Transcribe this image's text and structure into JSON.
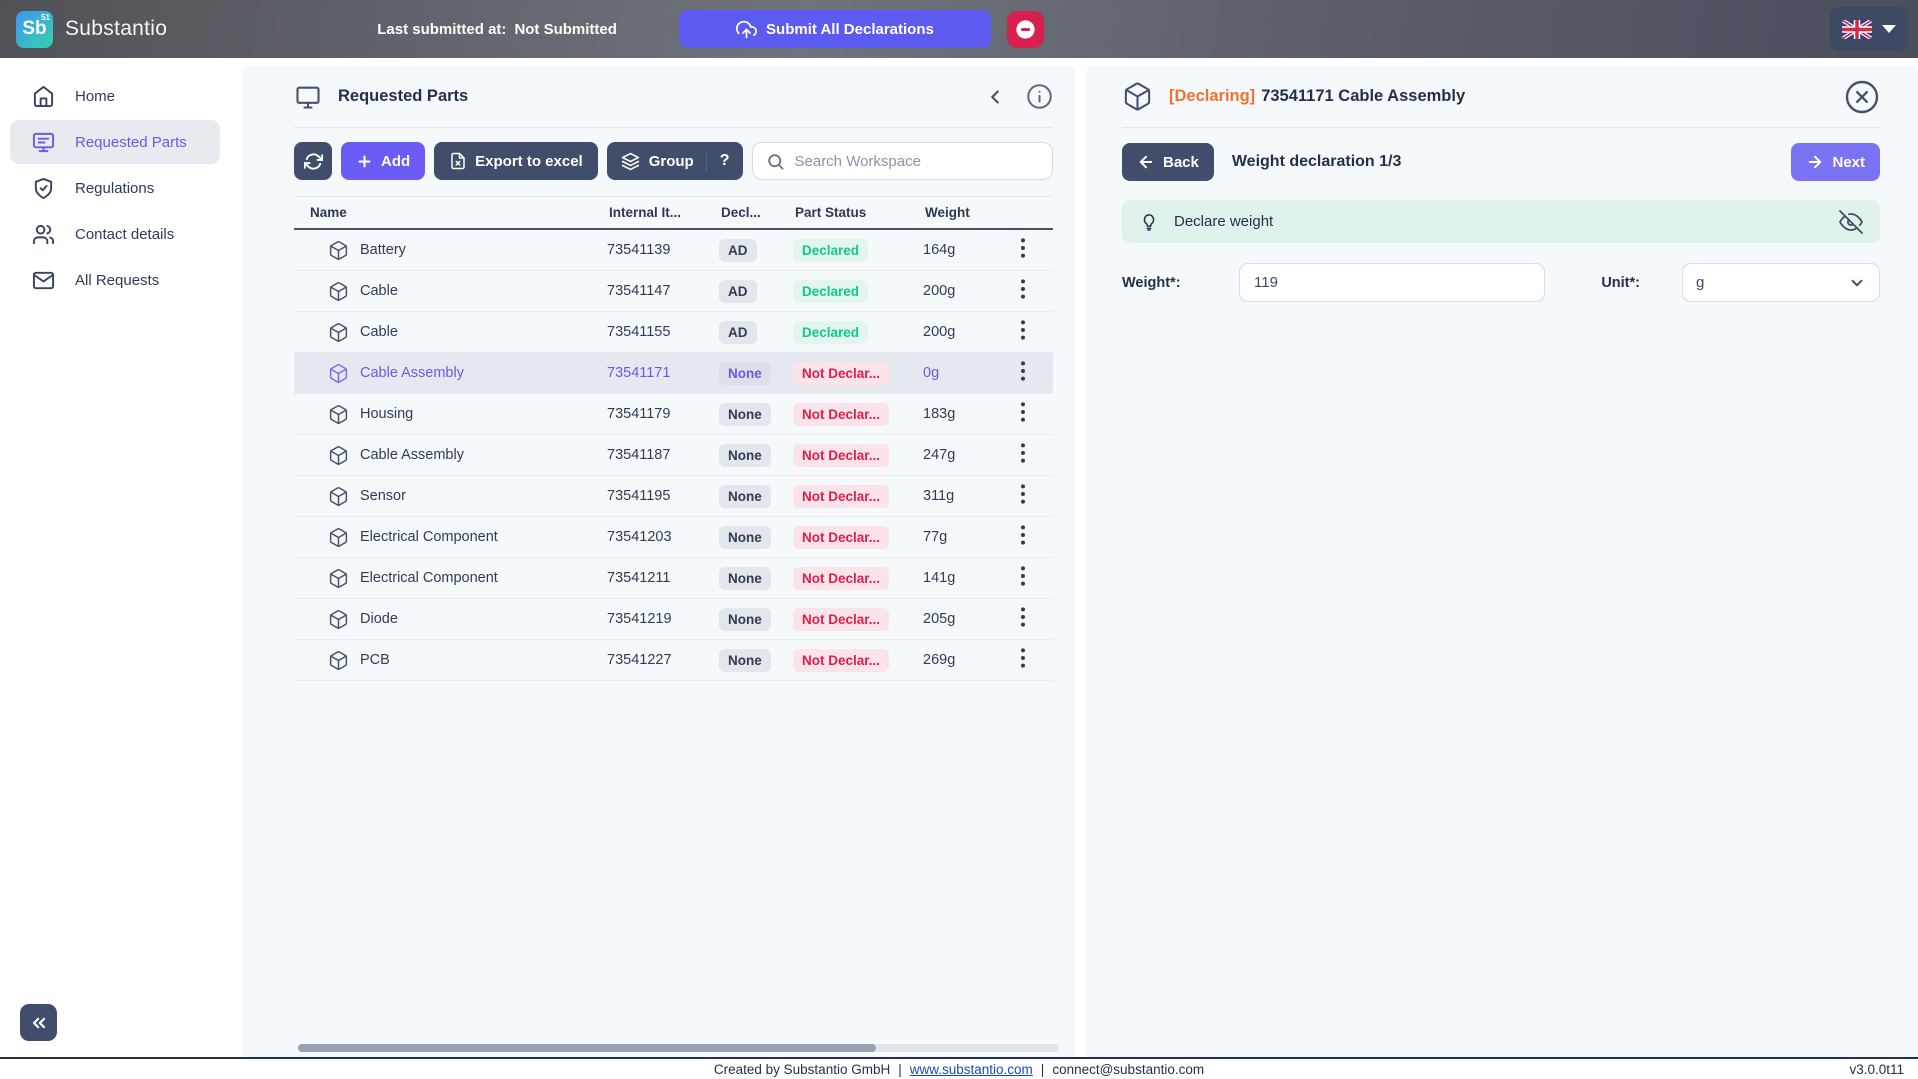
{
  "topbar": {
    "logo": {
      "symbol": "Sb",
      "superscript": "51",
      "app_name": "Substantio"
    },
    "last_submitted_label": "Last submitted at:",
    "last_submitted_value": "Not Submitted",
    "submit_button": "Submit All Declarations"
  },
  "sidebar": {
    "items": [
      {
        "label": "Home",
        "icon": "home-icon",
        "active": false
      },
      {
        "label": "Requested Parts",
        "icon": "monitor-icon",
        "active": true
      },
      {
        "label": "Regulations",
        "icon": "shield-check-icon",
        "active": false
      },
      {
        "label": "Contact details",
        "icon": "users-icon",
        "active": false
      },
      {
        "label": "All Requests",
        "icon": "mail-icon",
        "active": false
      }
    ]
  },
  "parts_panel": {
    "title": "Requested Parts",
    "toolbar": {
      "add": "Add",
      "export": "Export to excel",
      "group": "Group",
      "help": "?",
      "search_placeholder": "Search Workspace"
    },
    "table": {
      "columns": [
        "Name",
        "Internal It...",
        "Decl...",
        "Part Status",
        "Weight"
      ],
      "rows": [
        {
          "name": "Battery",
          "internal": "73541139",
          "decl": "AD",
          "status": "Declared",
          "status_type": "declared",
          "weight": "164g",
          "selected": false
        },
        {
          "name": "Cable",
          "internal": "73541147",
          "decl": "AD",
          "status": "Declared",
          "status_type": "declared",
          "weight": "200g",
          "selected": false
        },
        {
          "name": "Cable",
          "internal": "73541155",
          "decl": "AD",
          "status": "Declared",
          "status_type": "declared",
          "weight": "200g",
          "selected": false
        },
        {
          "name": "Cable Assembly",
          "internal": "73541171",
          "decl": "None",
          "status": "Not Declar...",
          "status_type": "not-declared",
          "weight": "0g",
          "selected": true
        },
        {
          "name": "Housing",
          "internal": "73541179",
          "decl": "None",
          "status": "Not Declar...",
          "status_type": "not-declared",
          "weight": "183g",
          "selected": false
        },
        {
          "name": "Cable Assembly",
          "internal": "73541187",
          "decl": "None",
          "status": "Not Declar...",
          "status_type": "not-declared",
          "weight": "247g",
          "selected": false
        },
        {
          "name": "Sensor",
          "internal": "73541195",
          "decl": "None",
          "status": "Not Declar...",
          "status_type": "not-declared",
          "weight": "311g",
          "selected": false
        },
        {
          "name": "Electrical Component",
          "internal": "73541203",
          "decl": "None",
          "status": "Not Declar...",
          "status_type": "not-declared",
          "weight": "77g",
          "selected": false
        },
        {
          "name": "Electrical Component",
          "internal": "73541211",
          "decl": "None",
          "status": "Not Declar...",
          "status_type": "not-declared",
          "weight": "141g",
          "selected": false
        },
        {
          "name": "Diode",
          "internal": "73541219",
          "decl": "None",
          "status": "Not Declar...",
          "status_type": "not-declared",
          "weight": "205g",
          "selected": false
        },
        {
          "name": "PCB",
          "internal": "73541227",
          "decl": "None",
          "status": "Not Declar...",
          "status_type": "not-declared",
          "weight": "269g",
          "selected": false
        }
      ]
    }
  },
  "declaration_panel": {
    "status_prefix": "[Declaring]",
    "title": "73541171 Cable Assembly",
    "back_button": "Back",
    "step_title": "Weight declaration 1/3",
    "next_button": "Next",
    "hint_text": "Declare weight",
    "form": {
      "weight_label": "Weight*:",
      "weight_value": "119",
      "unit_label": "Unit*:",
      "unit_value": "g"
    }
  },
  "footer": {
    "created_by": "Created by Substantio GmbH",
    "separator": "|",
    "website": "www.substantio.com",
    "email": "connect@substantio.com",
    "version": "v3.0.0t11"
  },
  "colors": {
    "accent_purple": "#655BE8",
    "button_purple": "#5D5AF0",
    "dark_slate": "#414E6B",
    "danger_red": "#D6204E",
    "declared_green": "#0EC98C",
    "not_declared_red": "#E01E4B",
    "declaring_orange": "#F2732E",
    "hint_mint": "#DFF3EC"
  }
}
